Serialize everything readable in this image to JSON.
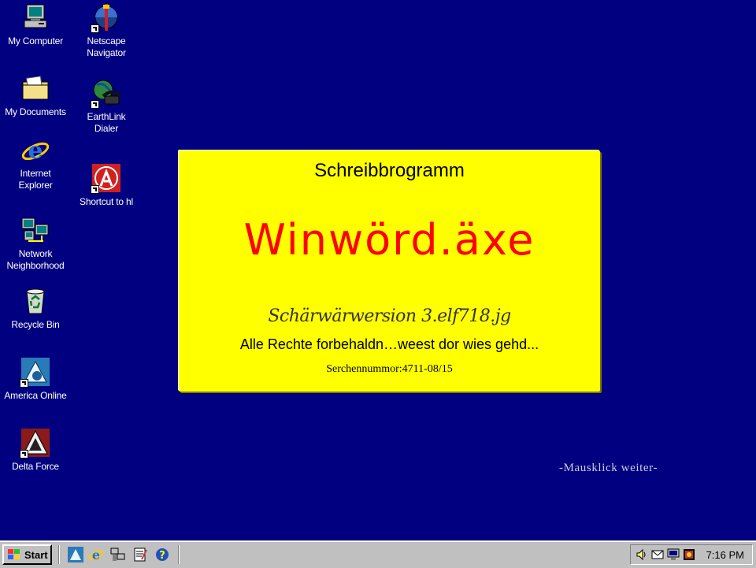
{
  "desktop": {
    "icons": [
      {
        "label": "My Computer"
      },
      {
        "label": "My Documents"
      },
      {
        "label": "Internet\nExplorer"
      },
      {
        "label": "Network\nNeighborhood"
      },
      {
        "label": "Recycle Bin"
      },
      {
        "label": "America Online"
      },
      {
        "label": "Delta Force"
      },
      {
        "label": "Netscape\nNavigator"
      },
      {
        "label": "EarthLink\nDialer"
      },
      {
        "label": "Shortcut to hl"
      }
    ],
    "background_color": "#000080"
  },
  "splash": {
    "title": "Schreibbrogramm",
    "app_name": "Winwörd.äxe",
    "version": "Schärwärwersion 3.elf718.jg",
    "rights": "Alle Rechte forbehaldn…weest dor wies gehd...",
    "serial": "Serchennummor:4711-08/15",
    "background_color": "#ffff00",
    "accent_color": "#ff0000"
  },
  "hint": "-Mausklick weiter-",
  "taskbar": {
    "start_label": "Start",
    "quick_launch": [
      "aol-icon",
      "internet-explorer-icon",
      "network-icon",
      "notepad-icon",
      "help-icon"
    ],
    "tray_icons": [
      "speaker-icon",
      "mail-icon",
      "monitor-icon",
      "scheduler-icon"
    ],
    "clock": "7:16 PM"
  }
}
